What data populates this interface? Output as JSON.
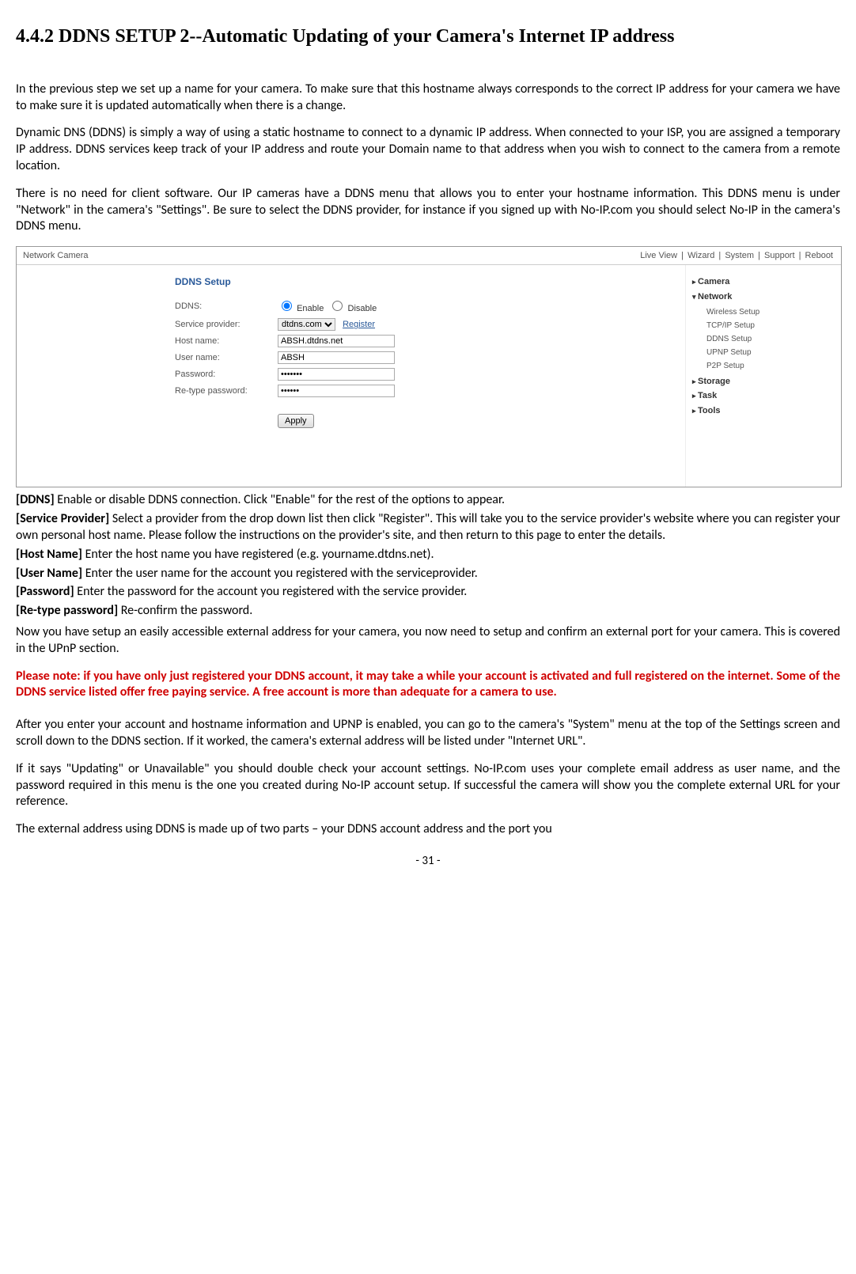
{
  "heading": "4.4.2 DDNS SETUP 2--Automatic Updating of your Camera's Internet IP address",
  "para1": "In the previous step we set up a name for your camera. To make sure that this hostname always corresponds to the correct IP address for your camera we have to make sure it is updated automatically when there is a change.",
  "para2": "Dynamic DNS (DDNS) is simply a way of using a static hostname to connect to a dynamic IP address. When connected to your ISP, you are assigned a temporary IP address. DDNS services keep track of your IP address and route your Domain name to that address when you wish to connect to the camera from a remote location.",
  "para3": "There is no need for client software. Our IP cameras have a DDNS menu that allows you to enter your hostname information. This DDNS menu is under \"Network\" in the camera's \"Settings\". Be sure to select the DDNS provider, for instance if you signed up with No-IP.com you should select No-IP in the camera's DDNS menu.",
  "screenshot": {
    "title": "Network Camera",
    "nav": [
      "Live View",
      "Wizard",
      "System",
      "Support",
      "Reboot"
    ],
    "form_title": "DDNS Setup",
    "fields": {
      "ddns_label": "DDNS:",
      "enable": "Enable",
      "disable": "Disable",
      "sp_label": "Service provider:",
      "sp_value": "dtdns.com",
      "register": "Register",
      "host_label": "Host name:",
      "host_value": "ABSH.dtdns.net",
      "user_label": "User name:",
      "user_value": "ABSH",
      "pw_label": "Password:",
      "pw_value": "•••••••",
      "rpw_label": "Re-type password:",
      "rpw_value": "••••••",
      "apply": "Apply"
    },
    "side": {
      "camera": "Camera",
      "network": "Network",
      "subs": [
        "Wireless Setup",
        "TCP/IP Setup",
        "DDNS Setup",
        "UPNP Setup",
        "P2P Setup"
      ],
      "storage": "Storage",
      "task": "Task",
      "tools": "Tools"
    }
  },
  "defs": {
    "ddns_l": "[DDNS] ",
    "ddns_t": "Enable or disable DDNS connection. Click \"Enable\" for the rest of the options to appear.",
    "sp_l": "[Service Provider] ",
    "sp_t": "Select a provider from the drop down list then click \"Register\". This will take you to the service provider's website where you can register your own personal host name. Please follow the instructions on the provider's site, and then return to this page to enter the details.",
    "hn_l": "[Host Name] ",
    "hn_t": "Enter the host name you have registered (e.g. yourname.dtdns.net).",
    "un_l": "[User Name] ",
    "un_t": "Enter the user name for the account you registered with the serviceprovider.",
    "pw_l": "[Password] ",
    "pw_t": "Enter the password for the account you registered with the service provider.",
    "rpw_l": "[Re-type password] ",
    "rpw_t": "Re-confirm the password."
  },
  "para4": "Now you have setup an easily accessible external address for your camera, you now need to setup and confirm an external port for your camera. This is covered in the UPnP section.",
  "note": "Please note: if you have only just registered your DDNS account, it may take a while your account is activated and full registered on the internet. Some of the DDNS service listed offer free paying service. A free account is more than adequate for a camera to use.",
  "para5": "After you enter your account and hostname information and UPNP is enabled, you can go to the camera's \"System\" menu at the top of the Settings screen and scroll down to the DDNS section. If it worked, the camera's external address will be listed under \"Internet URL\".",
  "para6": "If it says \"Updating\" or Unavailable\" you should double check your account settings. No-IP.com uses your complete email address as user name, and the password required in this menu is the one you created during No-IP account setup. If successful the camera will show you the complete external URL for your reference.",
  "para7": "The external address using DDNS is made up of two parts – your DDNS account address and the port you",
  "page_no": "- 31 -"
}
